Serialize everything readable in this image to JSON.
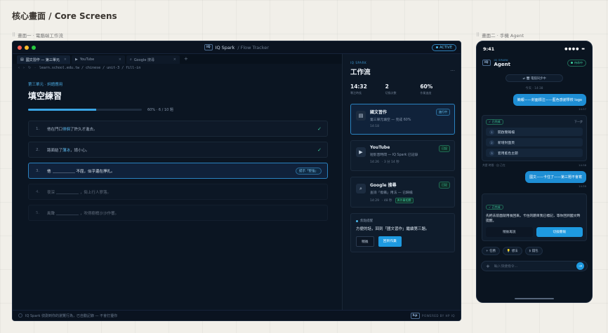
{
  "page": {
    "title": "核心畫面 / Core Screens"
  },
  "sections": {
    "desktop_label": "畫面一 · 電腦端工作流",
    "phone_label": "畫面二 · 手機 Agent"
  },
  "desktop": {
    "brand": "IQ Spark",
    "brand_logo": "IQ",
    "brand_sub": "/ Flow Tracker",
    "active": "ACTIVE",
    "tabs": [
      {
        "label": "國文習作 — 第三單元"
      },
      {
        "label": "YouTube"
      },
      {
        "label": "Google 搜尋"
      }
    ],
    "tab_close": "×",
    "tab_add": "+",
    "url": "learn.school.edu.tw / chinese / unit-3 / fill-in",
    "content": {
      "unit": "第三單元 · 詞語應用",
      "title": "填空練習",
      "progress": 0.6,
      "progress_text": "60% · 6 / 10 題",
      "questions": [
        {
          "num": "1.",
          "before": "他在門口",
          "word": "徘徊",
          "after": "了許久才進去。",
          "check": "✓"
        },
        {
          "num": "2.",
          "before": "路面結了",
          "word": "薄冰",
          "after": "，請小心。",
          "check": "✓"
        },
        {
          "num": "3.",
          "before": "他",
          "after": "不屈，似乎還在掙扎。",
          "hint": "提示「堅強」"
        },
        {
          "num": "4.",
          "before": "夜深",
          "after": "，街上行人寥落。"
        },
        {
          "num": "5.",
          "before": "風聲",
          "after": "，吹得樹梢沙沙作響。"
        }
      ]
    },
    "status": "IQ Spark 偵測到你的瀏覽行為，已自動記錄 — 不會打擾你",
    "powered": "POWERED BY HP IQ",
    "powered_logo": "hp"
  },
  "panel": {
    "brand": "IQ SPARK",
    "title": "工作流",
    "more": "···",
    "stats": [
      {
        "value": "14:32",
        "label": "專注時長"
      },
      {
        "value": "2",
        "label": "切換次數"
      },
      {
        "value": "60%",
        "label": "作業進度"
      }
    ],
    "cards": [
      {
        "name": "國文習作",
        "desc": "第三單元填空 — 完成 60%",
        "time": "14:18",
        "badge": "進行中"
      },
      {
        "name": "YouTube",
        "desc": "短影音時間 — IQ Spark 已記錄",
        "time": "14:26",
        "duration": "· 3 分 14 秒",
        "badge": "已記"
      },
      {
        "name": "Google 搜尋",
        "desc": "查詢「撥霧」用法 — 已歸檔",
        "time": "14:29",
        "duration": "· 48 秒",
        "tag": "與作業相關",
        "badge": "已記"
      }
    ],
    "notice": {
      "label": "焦點提醒",
      "text": "方便的話，回到「國文習作」繼續第三題。",
      "later": "稍後",
      "back": "回到作業"
    }
  },
  "phone": {
    "time": "9:41",
    "signal": "●●●● ▬",
    "brand": "IQ SPARK",
    "brand_logo": "IQ",
    "title": "Agent",
    "online": "待命中",
    "sync": "⇄  🖥  電腦同步中",
    "day": "今天 · 14:38",
    "user_msg_1": "簡報——封面標注——藍色感謝學校 logo",
    "user_time_1": "14:37",
    "card1": {
      "done": "✓ 已完成",
      "next": "下一步",
      "steps": [
        "開啟簡報檔",
        "新增封面頁",
        "套用藍色主題"
      ],
      "meta_left": "共歷 時間 · 自 己在",
      "meta_right": "14:38"
    },
    "user_msg_2": "國文——卡住了——第三題不會寫",
    "user_time_2": "14:39",
    "card2": {
      "done": "✓ 已完成",
      "body": "先把去前面就用後回來。卡住的題目我已標記，等你回到國文時提醒。",
      "later": "稍後再說",
      "go": "切換簡報"
    },
    "chips": [
      "+ 任務",
      "💡 想法",
      "$ 錢包"
    ],
    "input_placeholder": "輸入快捷指令...",
    "send": "→"
  },
  "colors": {
    "accent": "#1e9ae0",
    "success": "#3dd3a0",
    "bg_dark": "#0c1624"
  },
  "icons": {
    "tab1": "doc-icon",
    "tab2": "play-icon",
    "tab3": "search-icon"
  }
}
